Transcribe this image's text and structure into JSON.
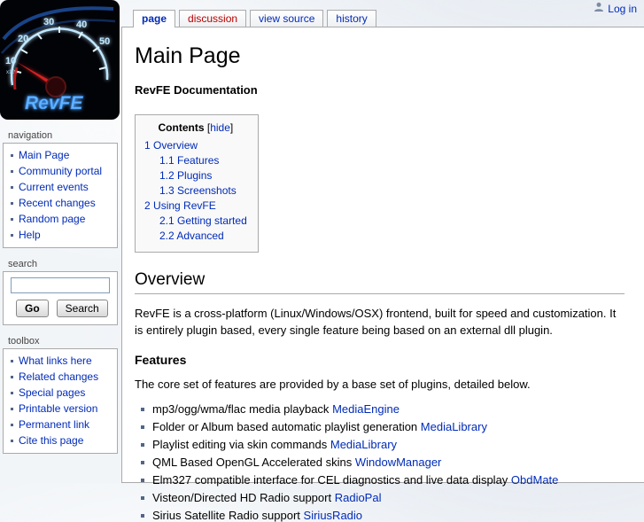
{
  "user_bar": {
    "login": "Log in"
  },
  "tabs": [
    {
      "label": "page"
    },
    {
      "label": "discussion"
    },
    {
      "label": "view source"
    },
    {
      "label": "history"
    }
  ],
  "sidebar": {
    "logo": {
      "brand": "RevFE",
      "scale_label": "x100",
      "gauge_numbers": [
        "10",
        "20",
        "30",
        "40",
        "50"
      ]
    },
    "navigation": {
      "title": "navigation",
      "items": [
        "Main Page",
        "Community portal",
        "Current events",
        "Recent changes",
        "Random page",
        "Help"
      ]
    },
    "search": {
      "title": "search",
      "value": "",
      "go_label": "Go",
      "search_label": "Search"
    },
    "toolbox": {
      "title": "toolbox",
      "items": [
        "What links here",
        "Related changes",
        "Special pages",
        "Printable version",
        "Permanent link",
        "Cite this page"
      ]
    }
  },
  "content": {
    "page_title": "Main Page",
    "subtitle": "RevFE Documentation",
    "toc": {
      "title": "Contents",
      "bracket_open": "[",
      "hide_label": "hide",
      "bracket_close": "]",
      "entries": [
        {
          "num": "1",
          "label": "Overview"
        },
        {
          "num": "1.1",
          "label": "Features"
        },
        {
          "num": "1.2",
          "label": "Plugins"
        },
        {
          "num": "1.3",
          "label": "Screenshots"
        },
        {
          "num": "2",
          "label": "Using RevFE"
        },
        {
          "num": "2.1",
          "label": "Getting started"
        },
        {
          "num": "2.2",
          "label": "Advanced"
        }
      ]
    },
    "overview": {
      "heading": "Overview",
      "paragraph": "RevFE is a cross-platform (Linux/Windows/OSX) frontend, built for speed and customization. It is entirely plugin based, every single feature being based on an external dll plugin."
    },
    "features": {
      "heading": "Features",
      "intro": "The core set of features are provided by a base set of plugins, detailed below.",
      "items": [
        {
          "text": "mp3/ogg/wma/flac media playback",
          "link": "MediaEngine"
        },
        {
          "text": "Folder or Album based automatic playlist generation",
          "link": "MediaLibrary"
        },
        {
          "text": "Playlist editing via skin commands",
          "link": "MediaLibrary"
        },
        {
          "text": "QML Based OpenGL Accelerated skins",
          "link": "WindowManager"
        },
        {
          "text": "Elm327 compatible interface for CEL diagnostics and live data display",
          "link": "ObdMate"
        },
        {
          "text": "Visteon/Directed HD Radio support",
          "link": "RadioPal"
        },
        {
          "text": "Sirius Satellite Radio support",
          "link": "SiriusRadio"
        }
      ]
    }
  },
  "colors": {
    "link": "#002bb8",
    "new_link": "#ba0000",
    "border": "#aaaaaa"
  }
}
